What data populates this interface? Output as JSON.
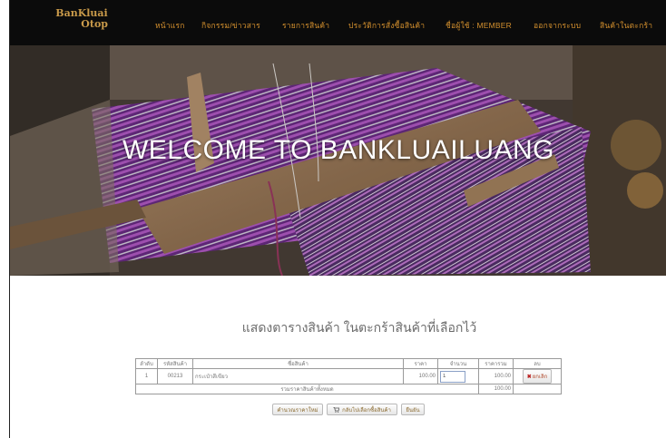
{
  "brand": {
    "line1": "BanKluai",
    "line2": "Otop"
  },
  "nav": [
    {
      "label": "หน้าแรก"
    },
    {
      "label": "กิจกรรม/ข่าวสาร"
    },
    {
      "label": "รายการสินค้า"
    },
    {
      "label": "ประวัติการสั่งซื้อสินค้า"
    },
    {
      "label": "ชื่อผู้ใช้ : MEMBER"
    },
    {
      "label": "ออกจากระบบ"
    },
    {
      "label": "สินค้าในตะกร้า"
    }
  ],
  "hero": {
    "title": "WELCOME TO BANKLUAILUANG"
  },
  "cart": {
    "heading": "แสดงตารางสินค้า ในตะกร้าสินค้าที่เลือกไว้",
    "columns": [
      "ลำดับ",
      "รหัสสินค้า",
      "ชื่อสินค้า",
      "ราคา",
      "จำนวน",
      "ราคารวม",
      "ลบ"
    ],
    "rows": [
      {
        "no": "1",
        "code": "00213",
        "name": "กระเป๋าสีเขียว",
        "price": "100.00",
        "qty": "1",
        "total": "100.00",
        "delete_label": "ยกเลิก"
      }
    ],
    "summary_label": "รวมราคาสินค้าทั้งหมด",
    "summary_value": "100.00"
  },
  "buttons": {
    "recalc": "คำนวณราคาใหม่",
    "continue_shopping": "กลับไปเลือกซื้อสินค้า",
    "confirm": "ยืนยัน"
  },
  "colors": {
    "navbar_bg": "#0b0b0b",
    "nav_text": "#d4902e",
    "brand": "#c99a4a"
  },
  "icons": {
    "delete": "close-icon",
    "continue": "cart-icon"
  }
}
